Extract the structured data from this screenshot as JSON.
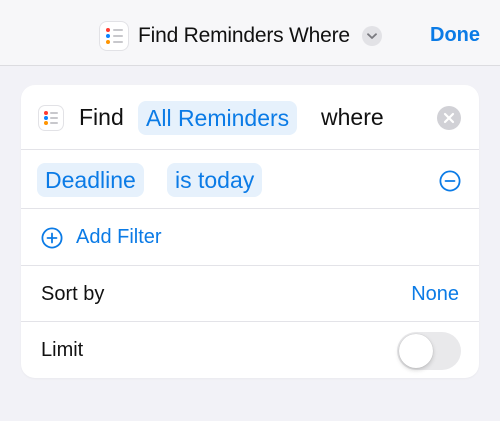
{
  "header": {
    "title": "Find Reminders Where",
    "done_label": "Done"
  },
  "find_row": {
    "find_word": "Find",
    "entity": "All Reminders",
    "where_word": "where"
  },
  "filter": {
    "field": "Deadline",
    "condition": "is today"
  },
  "add_filter_label": "Add Filter",
  "sort": {
    "label": "Sort by",
    "value": "None"
  },
  "limit": {
    "label": "Limit",
    "enabled": false
  },
  "colors": {
    "accent": "#0b7be6",
    "token_bg": "#e6f1fc",
    "background": "#f2f2f7"
  },
  "icons": {
    "app": "reminders-list-icon",
    "chevron": "chevron-down-icon",
    "clear": "clear-icon",
    "remove": "minus-circle-icon",
    "add": "plus-circle-icon"
  }
}
